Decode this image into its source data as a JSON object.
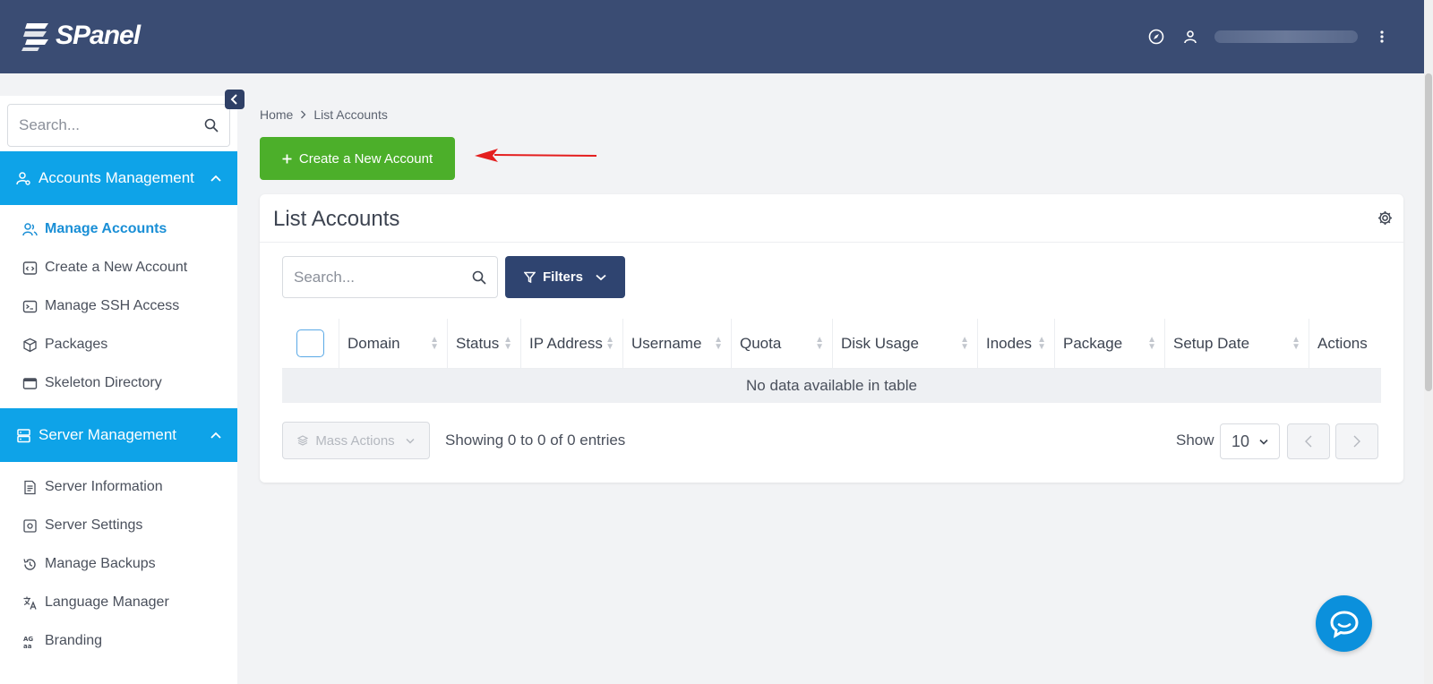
{
  "app": {
    "logo_text": "SPanel"
  },
  "topbar": {
    "icons": [
      "compass-icon",
      "user-icon",
      "more-vertical-icon"
    ]
  },
  "sidebar": {
    "search_placeholder": "Search...",
    "sections": [
      {
        "label": "Accounts Management",
        "items": [
          {
            "label": "Manage Accounts",
            "icon": "users-icon",
            "active": true
          },
          {
            "label": "Create a New Account",
            "icon": "code-window-icon"
          },
          {
            "label": "Manage SSH Access",
            "icon": "terminal-icon"
          },
          {
            "label": "Packages",
            "icon": "box-icon"
          },
          {
            "label": "Skeleton Directory",
            "icon": "layout-icon"
          }
        ]
      },
      {
        "label": "Server Management",
        "items": [
          {
            "label": "Server Information",
            "icon": "document-icon"
          },
          {
            "label": "Server Settings",
            "icon": "settings-box-icon"
          },
          {
            "label": "Manage Backups",
            "icon": "history-icon"
          },
          {
            "label": "Language Manager",
            "icon": "translate-icon"
          },
          {
            "label": "Branding",
            "icon": "branding-icon"
          }
        ]
      }
    ]
  },
  "breadcrumb": {
    "home": "Home",
    "current": "List Accounts"
  },
  "create_button": {
    "label": "Create a New Account"
  },
  "card": {
    "title": "List Accounts",
    "search_placeholder": "Search...",
    "filters_label": "Filters",
    "columns": [
      "Domain",
      "Status",
      "IP Address",
      "Username",
      "Quota",
      "Disk Usage",
      "Inodes",
      "Package",
      "Setup Date",
      "Actions"
    ],
    "empty_text": "No data available in table",
    "mass_actions_label": "Mass Actions",
    "showing_text": "Showing 0 to 0 of 0 entries",
    "show_label": "Show",
    "per_page": "10"
  },
  "colors": {
    "topbar": "#3a4c73",
    "accent": "#0ea3e8",
    "create": "#4caf2a",
    "filters": "#2f4470"
  }
}
